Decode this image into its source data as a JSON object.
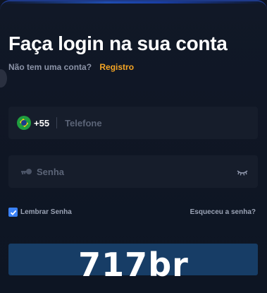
{
  "login": {
    "title": "Faça login na sua conta",
    "no_account_text": "Não tem uma conta?",
    "register_link": "Registro",
    "phone": {
      "country_flag": "brazil-flag-icon",
      "country_code": "+55",
      "placeholder": "Telefone",
      "value": ""
    },
    "password": {
      "placeholder": "Senha",
      "value": ""
    },
    "remember": {
      "label": "Lembrar Senha",
      "checked": true
    },
    "forgot_link": "Esqueceu a senha?",
    "watermark": "717br"
  },
  "colors": {
    "accent": "#f5a524",
    "checkbox": "#3b82f6",
    "button": "#173d66",
    "field_bg": "#161d2b",
    "page_bg": "#111827"
  }
}
